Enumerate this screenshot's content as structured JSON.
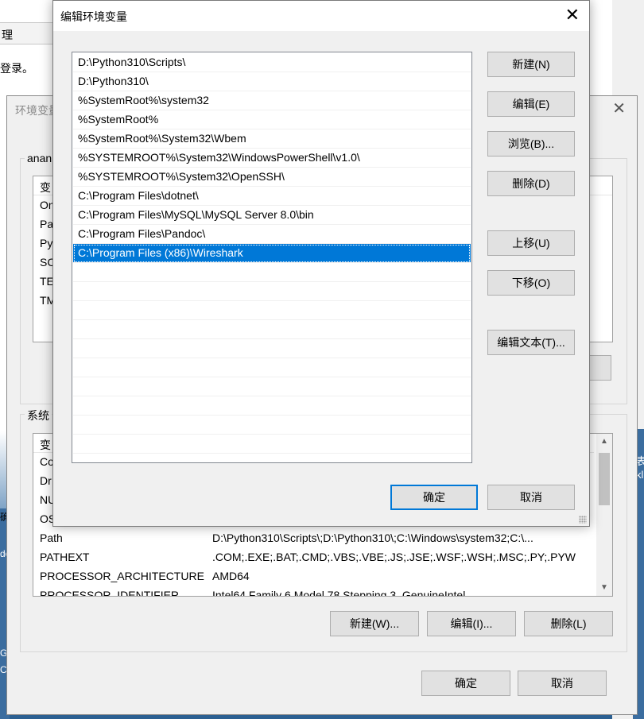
{
  "background": {
    "tab_label": "理",
    "login_text": "登录。",
    "right_text_1": "表",
    "right_text_2": "kl",
    "left_text_1": "确",
    "left_text_2": "de",
    "left_text_3": "G",
    "left_text_4": "C"
  },
  "env_dialog": {
    "title": "环境变量",
    "user_group_label": "anan",
    "user_list_header": "变",
    "user_rows": [
      "On",
      "Pa",
      "Py",
      "SC",
      "TE",
      "TM"
    ],
    "system_group_label": "系统",
    "system_header": "变",
    "system_rows": [
      {
        "name": "Co",
        "value": ""
      },
      {
        "name": "Dr",
        "value": ""
      },
      {
        "name": "NU",
        "value": ""
      },
      {
        "name": "OS",
        "value": ""
      },
      {
        "name": "Path",
        "value": "D:\\Python310\\Scripts\\;D:\\Python310\\;C:\\Windows\\system32;C:\\..."
      },
      {
        "name": "PATHEXT",
        "value": ".COM;.EXE;.BAT;.CMD;.VBS;.VBE;.JS;.JSE;.WSF;.WSH;.MSC;.PY;.PYW"
      },
      {
        "name": "PROCESSOR_ARCHITECTURE",
        "value": "AMD64"
      },
      {
        "name": "PROCESSOR_IDENTIFIER",
        "value": "Intel64 Family 6 Model 78 Stepping 3, GenuineIntel"
      }
    ],
    "new_label": "新建(W)...",
    "edit_label": "编辑(I)...",
    "delete_label": "删除(L)",
    "ok_label": "确定",
    "cancel_label": "取消"
  },
  "edit_dialog": {
    "title": "编辑环境变量",
    "close_icon": "close-icon",
    "paths": [
      "D:\\Python310\\Scripts\\",
      "D:\\Python310\\",
      "%SystemRoot%\\system32",
      "%SystemRoot%",
      "%SystemRoot%\\System32\\Wbem",
      "%SYSTEMROOT%\\System32\\WindowsPowerShell\\v1.0\\",
      "%SYSTEMROOT%\\System32\\OpenSSH\\",
      "C:\\Program Files\\dotnet\\",
      "C:\\Program Files\\MySQL\\MySQL Server 8.0\\bin",
      "C:\\Program Files\\Pandoc\\",
      "C:\\Program Files (x86)\\Wireshark"
    ],
    "selected_index": 10,
    "buttons": {
      "new": "新建(N)",
      "edit": "编辑(E)",
      "browse": "浏览(B)...",
      "delete": "删除(D)",
      "move_up": "上移(U)",
      "move_down": "下移(O)",
      "edit_text": "编辑文本(T)..."
    },
    "ok_label": "确定",
    "cancel_label": "取消",
    "selection_color": "#0078d7"
  }
}
